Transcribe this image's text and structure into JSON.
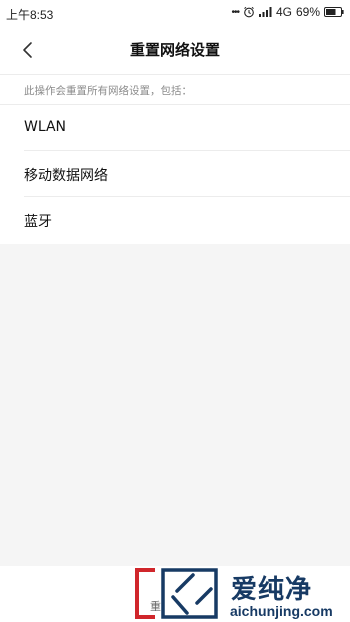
{
  "status_bar": {
    "time": "上午8:53",
    "dots": "•••",
    "network": "4G",
    "battery": "69%"
  },
  "header": {
    "title": "重置网络设置"
  },
  "description": "此操作会重置所有网络设置，包括：",
  "items": [
    {
      "label": "WLAN"
    },
    {
      "label": "移动数据网络"
    },
    {
      "label": "蓝牙"
    }
  ],
  "bottom": {
    "button_partial": "重"
  },
  "watermark": {
    "brand": "爱纯净",
    "url": "aichunjing.com"
  },
  "colors": {
    "watermark_red": "#d0262b",
    "watermark_blue": "#173a64"
  }
}
